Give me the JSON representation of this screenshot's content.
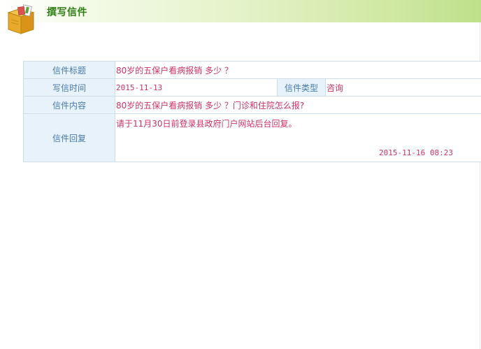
{
  "header": {
    "title": "撰写信件",
    "icon": "mail-box-icon"
  },
  "letter": {
    "title_label": "信件标题",
    "title_value": "80岁的五保户看病报销 多少 ？",
    "date_label": "写信时间",
    "date_value": "2015-11-13",
    "type_label": "信件类型",
    "type_value": "咨询",
    "content_label": "信件内容",
    "content_value": "80岁的五保户看病报销 多少 ？门诊和住院怎么报?",
    "reply_label": "信件回复",
    "reply_value": "请于11月30日前登录县政府门户网站后台回复。",
    "reply_date": "2015-11-16 08:23"
  },
  "colors": {
    "header_green": "#2e7d12",
    "label_blue": "#4a7aa7",
    "value_red": "#cc3366",
    "label_bg": "#e7f2fb"
  }
}
